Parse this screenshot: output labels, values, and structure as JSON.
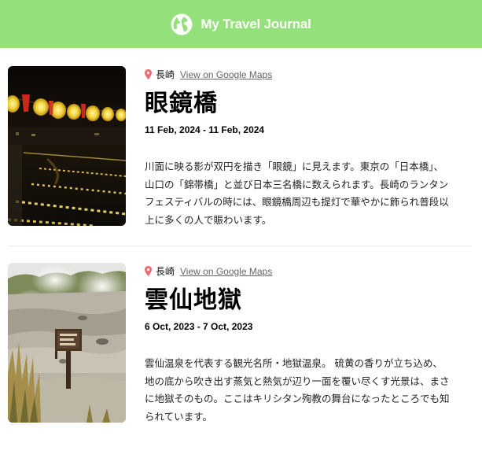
{
  "header": {
    "title": "My Travel Journal",
    "background_color": "#94e07a",
    "icon": "globe-icon"
  },
  "entries": [
    {
      "location": "長崎",
      "maps_link_label": "View on Google Maps",
      "title": "眼鏡橋",
      "dates": "11 Feb, 2024 - 11 Feb, 2024",
      "description": "川面に映る影が双円を描き「眼鏡」に見えます。東京の「日本橋」、山口の「錦帯橋」と並び日本三名橋に数えられます。長崎のランタンフェスティバルの時には、眼鏡橋周辺も提灯で華やかに飾られ普段以上に多くの人で賑わいます。"
    },
    {
      "location": "長崎",
      "maps_link_label": "View on Google Maps",
      "title": "雲仙地獄",
      "dates": "6 Oct, 2023 - 7 Oct, 2023",
      "description": "雲仙温泉を代表する観光名所・地獄温泉。 硫黄の香りが立ち込め、地の底から吹き出す蒸気と熱気が辺り一面を覆い尽くす光景は、まさに地獄そのもの。ここはキリシタン殉教の舞台になったところでも知られています。"
    }
  ]
}
